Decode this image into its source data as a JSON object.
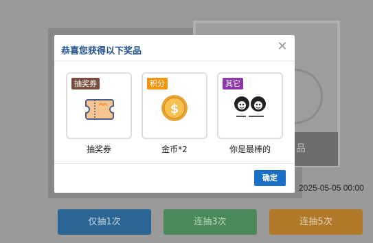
{
  "background": {
    "caption": "品",
    "date": "2025-05-05 00:00",
    "buttons": [
      "仅抽1次",
      "连抽3次",
      "连抽5次"
    ]
  },
  "modal": {
    "title": "恭喜您获得以下奖品",
    "confirm_label": "确定",
    "prizes": [
      {
        "tag": "抽奖券",
        "name": "抽奖券",
        "icon": "ticket-icon",
        "tag_color": "#7a4e3d"
      },
      {
        "tag": "积分",
        "name": "金币*2",
        "icon": "coin-icon",
        "tag_color": "#f0950e"
      },
      {
        "tag": "其它",
        "name": "你是最棒的",
        "icon": "meme-image",
        "tag_color": "#8e38a8"
      }
    ]
  }
}
